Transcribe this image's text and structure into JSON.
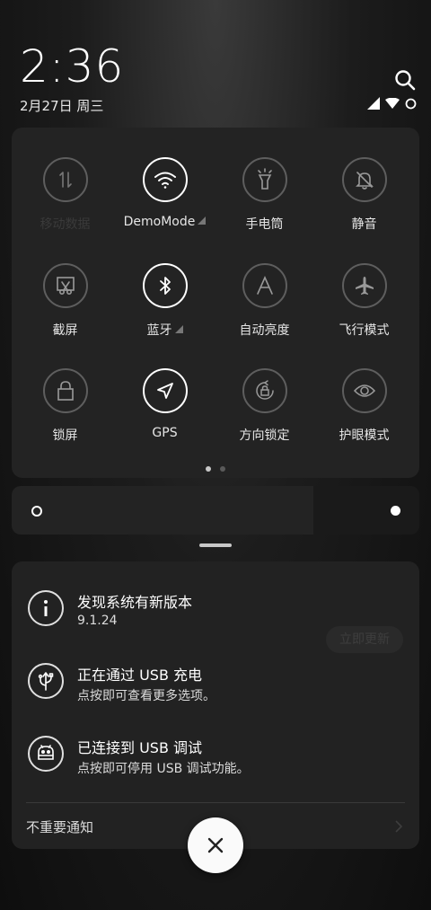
{
  "header": {
    "time": "2:36",
    "date": "2月27日 周三"
  },
  "tiles": [
    {
      "label": "移动数据",
      "icon": "mobile-data-icon",
      "on": false,
      "faded": true
    },
    {
      "label": "DemoMode",
      "icon": "wifi-icon",
      "on": true,
      "expand": true
    },
    {
      "label": "手电筒",
      "icon": "flashlight-icon",
      "on": false
    },
    {
      "label": "静音",
      "icon": "bell-off-icon",
      "on": false
    },
    {
      "label": "截屏",
      "icon": "screenshot-icon",
      "on": false
    },
    {
      "label": "蓝牙",
      "icon": "bluetooth-icon",
      "on": true,
      "expand": true
    },
    {
      "label": "自动亮度",
      "icon": "auto-brightness-icon",
      "on": false
    },
    {
      "label": "飞行模式",
      "icon": "airplane-icon",
      "on": false
    },
    {
      "label": "锁屏",
      "icon": "lock-icon",
      "on": false
    },
    {
      "label": "GPS",
      "icon": "location-arrow-icon",
      "on": true
    },
    {
      "label": "方向锁定",
      "icon": "rotation-lock-icon",
      "on": false
    },
    {
      "label": "护眼模式",
      "icon": "eye-icon",
      "on": false
    }
  ],
  "page_indicator": {
    "count": 2,
    "active": 1
  },
  "brightness": {
    "level": 0.74
  },
  "notifications": [
    {
      "title": "发现系统有新版本",
      "subtitle": "9.1.24",
      "icon": "info-icon",
      "action": "立即更新"
    },
    {
      "title": "正在通过 USB 充电",
      "subtitle": "点按即可查看更多选项。",
      "icon": "usb-charge-icon"
    },
    {
      "title": "已连接到 USB 调试",
      "subtitle": "点按即可停用 USB 调试功能。",
      "icon": "android-debug-icon"
    }
  ],
  "unimportant_label": "不重要通知",
  "icons": {
    "close": "close-icon",
    "search": "search-icon"
  }
}
